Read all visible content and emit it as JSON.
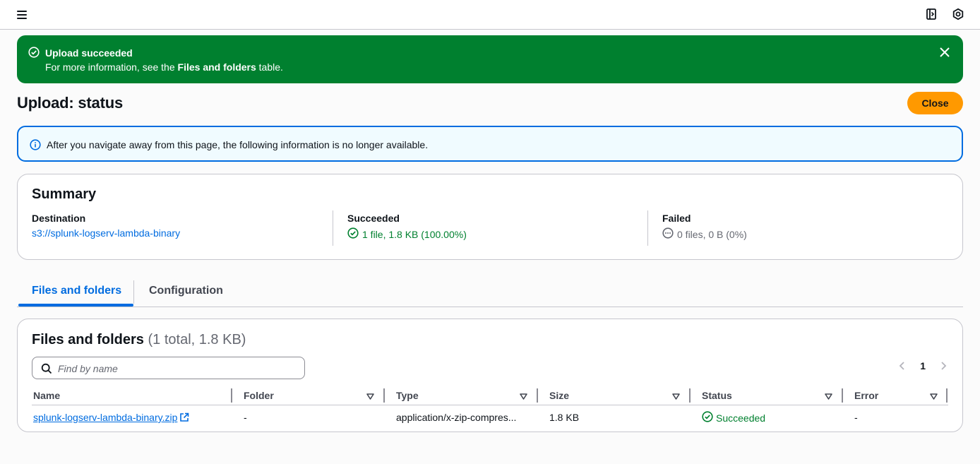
{
  "topbar": {
    "menu_icon": "hamburger-icon",
    "right_icons": [
      "panel-toggle-icon",
      "settings-hex-icon"
    ]
  },
  "flash": {
    "title": "Upload succeeded",
    "body_prefix": "For more information, see the ",
    "body_bold": "Files and folders",
    "body_suffix": " table.",
    "color": "#00802f"
  },
  "header": {
    "title": "Upload: status",
    "close_label": "Close",
    "close_color": "#ff9900"
  },
  "info": {
    "text": "After you navigate away from this page, the following information is no longer available."
  },
  "summary": {
    "title": "Summary",
    "destination_label": "Destination",
    "destination_value": "s3://splunk-logserv-lambda-binary",
    "succeeded_label": "Succeeded",
    "succeeded_value": "1 file, 1.8 KB (100.00%)",
    "failed_label": "Failed",
    "failed_value": "0 files, 0 B (0%)"
  },
  "tabs": [
    {
      "label": "Files and folders",
      "active": true
    },
    {
      "label": "Configuration",
      "active": false
    }
  ],
  "files": {
    "title": "Files and folders",
    "count": "(1 total, 1.8 KB)",
    "search_placeholder": "Find by name",
    "page": "1",
    "columns": [
      "Name",
      "Folder",
      "Type",
      "Size",
      "Status",
      "Error"
    ],
    "rows": [
      {
        "name": "splunk-logserv-lambda-binary.zip",
        "folder": "-",
        "type": "application/x-zip-compres...",
        "size": "1.8 KB",
        "status": "Succeeded",
        "error": "-"
      }
    ]
  }
}
